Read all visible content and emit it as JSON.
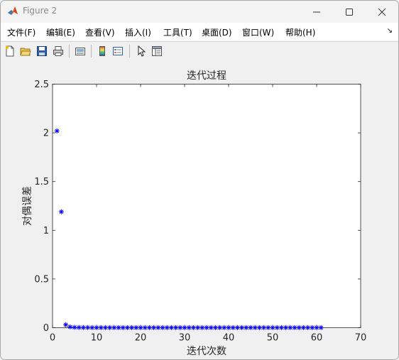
{
  "window": {
    "title": "Figure 2"
  },
  "menu": {
    "items": [
      {
        "label": "文件(F)"
      },
      {
        "label": "编辑(E)"
      },
      {
        "label": "查看(V)"
      },
      {
        "label": "插入(I)"
      },
      {
        "label": "工具(T)"
      },
      {
        "label": "桌面(D)"
      },
      {
        "label": "窗口(W)"
      },
      {
        "label": "帮助(H)"
      }
    ]
  },
  "toolbar": {
    "buttons": [
      "new-figure-icon",
      "open-file-icon",
      "save-icon",
      "print-icon",
      "link-plot-icon",
      "colorbar-icon",
      "legend-icon",
      "pointer-icon",
      "property-editor-icon"
    ]
  },
  "colors": {
    "marker": "#0000ff",
    "axes_bg": "#ffffff",
    "figure_bg": "#f0f0f0"
  },
  "chart_data": {
    "type": "scatter",
    "title": "迭代过程",
    "xlabel": "迭代次数",
    "ylabel": "对偶误差",
    "xlim": [
      0,
      70
    ],
    "ylim": [
      0,
      2.5
    ],
    "xticks": [
      0,
      10,
      20,
      30,
      40,
      50,
      60,
      70
    ],
    "yticks": [
      0,
      0.5,
      1,
      1.5,
      2,
      2.5
    ],
    "yticklabels": [
      "0",
      "0.5",
      "1",
      "1.5",
      "2",
      "2.5"
    ],
    "grid": false,
    "marker": "*",
    "x": [
      1,
      2,
      3,
      4,
      5,
      6,
      7,
      8,
      9,
      10,
      11,
      12,
      13,
      14,
      15,
      16,
      17,
      18,
      19,
      20,
      21,
      22,
      23,
      24,
      25,
      26,
      27,
      28,
      29,
      30,
      31,
      32,
      33,
      34,
      35,
      36,
      37,
      38,
      39,
      40,
      41,
      42,
      43,
      44,
      45,
      46,
      47,
      48,
      49,
      50,
      51,
      52,
      53,
      54,
      55,
      56,
      57,
      58,
      59,
      60,
      61
    ],
    "y": [
      2.02,
      1.19,
      0.03,
      0.008,
      0.004,
      0.003,
      0.002,
      0.002,
      0.001,
      0.001,
      0.001,
      0.001,
      0.001,
      0.001,
      0.001,
      0.001,
      0.001,
      0.001,
      0.001,
      0.001,
      0.001,
      0.001,
      0.001,
      0.001,
      0.001,
      0.001,
      0.001,
      0.001,
      0.001,
      0.001,
      0.001,
      0.001,
      0.001,
      0.001,
      0.001,
      0.001,
      0.001,
      0.001,
      0.001,
      0.001,
      0.001,
      0.001,
      0.001,
      0.001,
      0.001,
      0.001,
      0.001,
      0.001,
      0.001,
      0.001,
      0.001,
      0.001,
      0.001,
      0.001,
      0.001,
      0.001,
      0.001,
      0.001,
      0.001,
      0.001,
      0.001
    ]
  }
}
